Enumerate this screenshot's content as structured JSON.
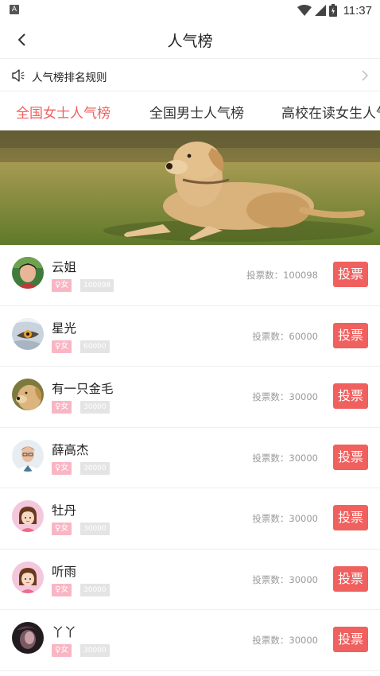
{
  "status_bar": {
    "app_icon_letter": "A",
    "time": "11:37"
  },
  "header": {
    "title": "人气榜"
  },
  "rules": {
    "label": "人气榜排名规则"
  },
  "tabs": [
    {
      "label": "全国女士人气榜",
      "active": true
    },
    {
      "label": "全国男士人气榜",
      "active": false
    },
    {
      "label": "高校在读女生人气榜",
      "active": false
    }
  ],
  "colors": {
    "accent": "#f0605e",
    "gender_badge": "#f8b6c4",
    "id_badge": "#e4e4e4"
  },
  "rankings": [
    {
      "name": "云姐",
      "gender": "♀女",
      "id": "100098",
      "votes": "投票数：100098",
      "vote_label": "投票",
      "avatar": "photo-woman"
    },
    {
      "name": "星光",
      "gender": "♀女",
      "id": "60000",
      "votes": "投票数：60000",
      "vote_label": "投票",
      "avatar": "photo-eye"
    },
    {
      "name": "有一只金毛",
      "gender": "♀女",
      "id": "30000",
      "votes": "投票数：30000",
      "vote_label": "投票",
      "avatar": "photo-dog"
    },
    {
      "name": "薛高杰",
      "gender": "♀女",
      "id": "30000",
      "votes": "投票数：30000",
      "vote_label": "投票",
      "avatar": "photo-man"
    },
    {
      "name": "牡丹",
      "gender": "♀女",
      "id": "30000",
      "votes": "投票数：30000",
      "vote_label": "投票",
      "avatar": "default-girl"
    },
    {
      "name": "听雨",
      "gender": "♀女",
      "id": "30000",
      "votes": "投票数：30000",
      "vote_label": "投票",
      "avatar": "default-girl"
    },
    {
      "name": "丫丫",
      "gender": "♀女",
      "id": "30000",
      "votes": "投票数：30000",
      "vote_label": "投票",
      "avatar": "photo-dark"
    }
  ]
}
